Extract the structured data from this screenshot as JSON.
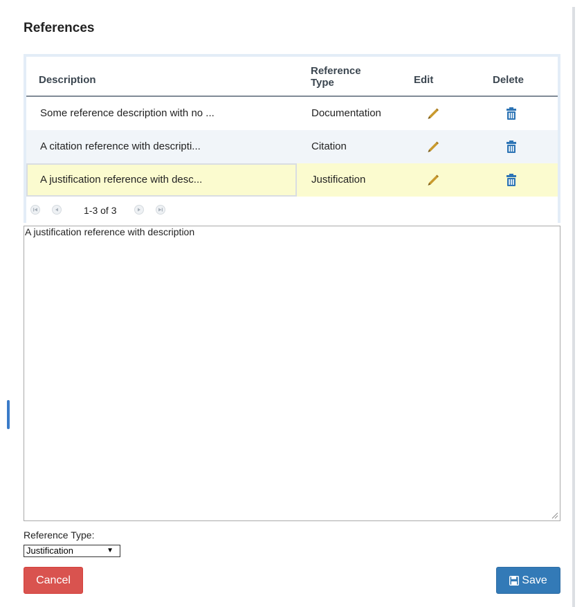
{
  "title": "References",
  "table": {
    "headers": {
      "description": "Description",
      "reference_type_line1": "Reference",
      "reference_type_line2": "Type",
      "edit": "Edit",
      "delete": "Delete"
    },
    "rows": [
      {
        "description": "Some reference description with no ...",
        "reference_type": "Documentation"
      },
      {
        "description": "A citation reference with descripti...",
        "reference_type": "Citation"
      },
      {
        "description": "A justification reference with desc...",
        "reference_type": "Justification"
      }
    ],
    "selected_row": 3,
    "pager": {
      "info": "1-3 of 3"
    }
  },
  "description_text": "A justification reference with description",
  "reference_type_label": "Reference Type:",
  "reference_type_select": {
    "selected": "Justification"
  },
  "buttons": {
    "cancel": "Cancel",
    "save": "Save"
  },
  "icons": {
    "edit": "pencil-icon",
    "delete": "trash-icon",
    "save": "floppy-disk-icon",
    "pager": [
      "first-page-icon",
      "previous-page-icon",
      "next-page-icon",
      "last-page-icon"
    ]
  },
  "colors": {
    "selected_row": "#fbfbcf",
    "alt_row": "#f1f5f9",
    "edit_icon": "#c99a2e",
    "delete_icon": "#2d74b5",
    "cancel_button": "#d9534f",
    "save_button": "#337ab7"
  }
}
